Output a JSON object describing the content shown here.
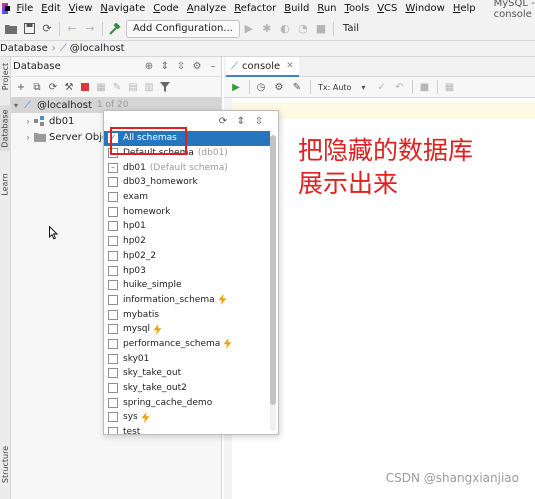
{
  "menubar": {
    "items": [
      "File",
      "Edit",
      "View",
      "Navigate",
      "Code",
      "Analyze",
      "Refactor",
      "Build",
      "Run",
      "Tools",
      "VCS",
      "Window",
      "Help"
    ],
    "window_title": "MySQL - console"
  },
  "toolbar": {
    "add_configuration": "Add Configuration...",
    "tail": "Tail"
  },
  "breadcrumb": {
    "items": [
      "Database",
      "@localhost"
    ]
  },
  "left_strip": {
    "tabs": [
      "Project",
      "Database",
      "Learn",
      "Structure"
    ]
  },
  "db_panel": {
    "title": "Database",
    "host": {
      "label": "@localhost",
      "count": "1 of 20"
    },
    "children": [
      {
        "label": "db01"
      },
      {
        "label": "Server Obje"
      }
    ]
  },
  "editor": {
    "tab": "console",
    "tx_mode": "Tx: Auto"
  },
  "schema_popup": {
    "items": [
      {
        "label": "All schemas",
        "checked": true,
        "selected": true
      },
      {
        "label": "Default schema",
        "sub": "(db01)",
        "checked": false
      },
      {
        "label": "db01",
        "sub": "(Default schema)",
        "checked": "partial"
      },
      {
        "label": "db03_homework"
      },
      {
        "label": "exam"
      },
      {
        "label": "homework"
      },
      {
        "label": "hp01"
      },
      {
        "label": "hp02"
      },
      {
        "label": "hp02_2"
      },
      {
        "label": "hp03"
      },
      {
        "label": "huike_simple"
      },
      {
        "label": "information_schema",
        "bolt": true
      },
      {
        "label": "mybatis"
      },
      {
        "label": "mysql",
        "bolt": true
      },
      {
        "label": "performance_schema",
        "bolt": true
      },
      {
        "label": "sky01"
      },
      {
        "label": "sky_take_out"
      },
      {
        "label": "sky_take_out2"
      },
      {
        "label": "spring_cache_demo"
      },
      {
        "label": "sys",
        "bolt": true
      },
      {
        "label": "test"
      }
    ]
  },
  "annotation": {
    "line1": "把隐藏的数据库",
    "line2": "展示出来"
  },
  "watermark": "CSDN @shangxianjiao",
  "colors": {
    "selection": "#2675bf",
    "annotation_red": "#e0201f",
    "bolt": "#f0a30a"
  },
  "icons": {
    "run": "run-icon",
    "refresh": "refresh-icon",
    "filter": "filter-icon"
  }
}
